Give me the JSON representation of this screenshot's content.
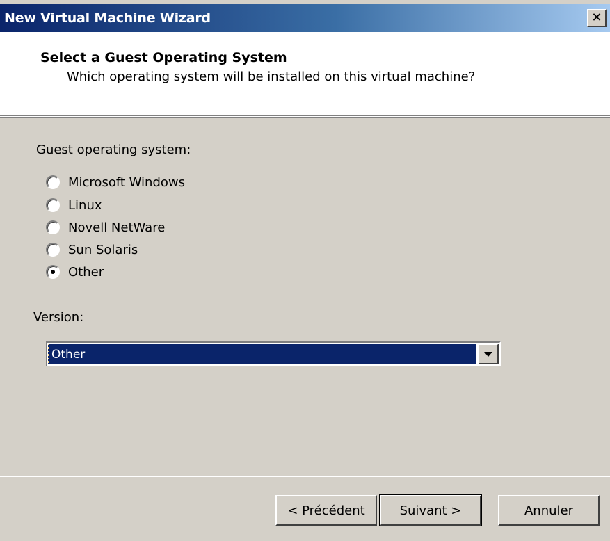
{
  "window": {
    "title": "New Virtual Machine Wizard",
    "close_glyph": "✕"
  },
  "header": {
    "heading": "Select a Guest Operating System",
    "subheading": "Which operating system will be installed on this virtual machine?"
  },
  "guest_os": {
    "label": "Guest operating system:",
    "options": [
      {
        "label": "Microsoft Windows",
        "checked": false
      },
      {
        "label": "Linux",
        "checked": false
      },
      {
        "label": "Novell NetWare",
        "checked": false
      },
      {
        "label": "Sun Solaris",
        "checked": false
      },
      {
        "label": "Other",
        "checked": true
      }
    ]
  },
  "version": {
    "label": "Version:",
    "selected": "Other"
  },
  "buttons": {
    "previous": "< Précédent",
    "next": "Suivant >",
    "cancel": "Annuler"
  },
  "colors": {
    "titlebar_start": "#0a246a",
    "titlebar_end": "#a6caf0",
    "dialog_face": "#d4d0c8",
    "selection": "#0a246a"
  }
}
